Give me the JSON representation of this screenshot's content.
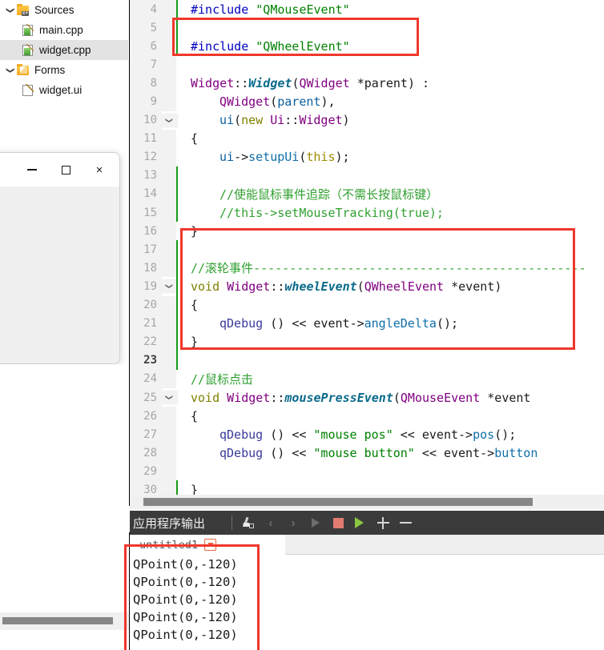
{
  "project_tree": {
    "items": [
      {
        "label": "Sources",
        "icon": "folder-cpp-icon",
        "arrow": "chevron-down-icon",
        "level": 0,
        "selected": false
      },
      {
        "label": "main.cpp",
        "icon": "cpp-file-icon",
        "arrow": "",
        "level": 1,
        "selected": false
      },
      {
        "label": "widget.cpp",
        "icon": "cpp-file-icon",
        "arrow": "",
        "level": 1,
        "selected": true
      },
      {
        "label": "Forms",
        "icon": "folder-forms-icon",
        "arrow": "chevron-down-icon",
        "level": 0,
        "selected": false
      },
      {
        "label": "widget.ui",
        "icon": "ui-file-icon",
        "arrow": "",
        "level": 1,
        "selected": false
      }
    ]
  },
  "app_window": {
    "minimize_label": "minimize-icon",
    "maximize_label": "maximize-icon",
    "close_label": "×"
  },
  "editor": {
    "lines": [
      {
        "n": "4",
        "fold": "",
        "changed": true,
        "current": false,
        "indent": 0,
        "tokens": [
          {
            "t": "#include ",
            "c": "t-pre"
          },
          {
            "t": "\"QMouseEvent\"",
            "c": "t-str"
          }
        ]
      },
      {
        "n": "5",
        "fold": "",
        "changed": true,
        "current": false,
        "indent": 0,
        "tokens": []
      },
      {
        "n": "6",
        "fold": "",
        "changed": true,
        "current": false,
        "indent": 0,
        "tokens": [
          {
            "t": "#include ",
            "c": "t-pre"
          },
          {
            "t": "\"QWheelEvent\"",
            "c": "t-str"
          }
        ]
      },
      {
        "n": "7",
        "fold": "",
        "changed": false,
        "current": false,
        "indent": 0,
        "tokens": []
      },
      {
        "n": "8",
        "fold": "",
        "changed": false,
        "current": false,
        "indent": 0,
        "tokens": [
          {
            "t": "Widget",
            "c": "t-cls"
          },
          {
            "t": "::",
            "c": "t-punct"
          },
          {
            "t": "Widget",
            "c": "t-fn"
          },
          {
            "t": "(",
            "c": "t-punct"
          },
          {
            "t": "QWidget",
            "c": "t-cls"
          },
          {
            "t": " *parent",
            "c": "t-punct"
          },
          {
            "t": ")",
            "c": "t-punct"
          },
          {
            "t": " :",
            "c": "t-punct"
          }
        ]
      },
      {
        "n": "9",
        "fold": "",
        "changed": false,
        "current": false,
        "indent": 1,
        "tokens": [
          {
            "t": "QWidget",
            "c": "t-cls"
          },
          {
            "t": "(",
            "c": "t-punct"
          },
          {
            "t": "parent",
            "c": "t-var"
          },
          {
            "t": "),",
            "c": "t-punct"
          }
        ]
      },
      {
        "n": "10",
        "fold": "chevron-down",
        "changed": false,
        "current": false,
        "indent": 1,
        "tokens": [
          {
            "t": "ui",
            "c": "t-var"
          },
          {
            "t": "(",
            "c": "t-punct"
          },
          {
            "t": "new",
            "c": "t-kw"
          },
          {
            "t": " ",
            "c": "t-punct"
          },
          {
            "t": "Ui",
            "c": "t-cls"
          },
          {
            "t": "::",
            "c": "t-punct"
          },
          {
            "t": "Widget",
            "c": "t-cls"
          },
          {
            "t": ")",
            "c": "t-punct"
          }
        ]
      },
      {
        "n": "11",
        "fold": "",
        "changed": false,
        "current": false,
        "indent": 0,
        "tokens": [
          {
            "t": "{",
            "c": "t-punct"
          }
        ]
      },
      {
        "n": "12",
        "fold": "",
        "changed": false,
        "current": false,
        "indent": 1,
        "tokens": [
          {
            "t": "ui",
            "c": "t-var"
          },
          {
            "t": "->",
            "c": "t-punct"
          },
          {
            "t": "setupUi",
            "c": "t-fn2"
          },
          {
            "t": "(",
            "c": "t-punct"
          },
          {
            "t": "this",
            "c": "t-this"
          },
          {
            "t": ");",
            "c": "t-punct"
          }
        ]
      },
      {
        "n": "13",
        "fold": "",
        "changed": true,
        "current": false,
        "indent": 0,
        "tokens": []
      },
      {
        "n": "14",
        "fold": "",
        "changed": true,
        "current": false,
        "indent": 1,
        "tokens": [
          {
            "t": "//使能鼠标事件追踪（不需长按鼠标键）",
            "c": "t-cmt"
          }
        ]
      },
      {
        "n": "15",
        "fold": "",
        "changed": true,
        "current": false,
        "indent": 1,
        "tokens": [
          {
            "t": "//this->setMouseTracking(true);",
            "c": "t-cmt"
          }
        ]
      },
      {
        "n": "16",
        "fold": "",
        "changed": false,
        "current": false,
        "indent": 0,
        "tokens": [
          {
            "t": "}",
            "c": "t-punct"
          }
        ]
      },
      {
        "n": "17",
        "fold": "",
        "changed": true,
        "current": false,
        "indent": 0,
        "tokens": []
      },
      {
        "n": "18",
        "fold": "",
        "changed": true,
        "current": false,
        "indent": 0,
        "tokens": [
          {
            "t": "//滚轮事件----------------------------------------------",
            "c": "t-cmt"
          }
        ]
      },
      {
        "n": "19",
        "fold": "chevron-down",
        "changed": true,
        "current": false,
        "indent": 0,
        "tokens": [
          {
            "t": "void",
            "c": "t-kw"
          },
          {
            "t": " ",
            "c": "t-punct"
          },
          {
            "t": "Widget",
            "c": "t-cls"
          },
          {
            "t": "::",
            "c": "t-punct"
          },
          {
            "t": "wheelEvent",
            "c": "t-fn"
          },
          {
            "t": "(",
            "c": "t-punct"
          },
          {
            "t": "QWheelEvent",
            "c": "t-cls"
          },
          {
            "t": " *event",
            "c": "t-punct"
          },
          {
            "t": ")",
            "c": "t-punct"
          }
        ]
      },
      {
        "n": "20",
        "fold": "",
        "changed": true,
        "current": false,
        "indent": 0,
        "tokens": [
          {
            "t": "{",
            "c": "t-punct"
          }
        ]
      },
      {
        "n": "21",
        "fold": "",
        "changed": true,
        "current": false,
        "indent": 1,
        "tokens": [
          {
            "t": "qDebug",
            "c": "t-local"
          },
          {
            "t": " () ",
            "c": "t-punct"
          },
          {
            "t": "<<",
            "c": "t-punct"
          },
          {
            "t": " event",
            "c": "t-punct"
          },
          {
            "t": "->",
            "c": "t-punct"
          },
          {
            "t": "angleDelta",
            "c": "t-fn2"
          },
          {
            "t": "();",
            "c": "t-punct"
          }
        ]
      },
      {
        "n": "22",
        "fold": "",
        "changed": true,
        "current": false,
        "indent": 0,
        "tokens": [
          {
            "t": "}",
            "c": "t-punct"
          }
        ]
      },
      {
        "n": "23",
        "fold": "",
        "changed": true,
        "current": true,
        "indent": 0,
        "tokens": []
      },
      {
        "n": "24",
        "fold": "",
        "changed": false,
        "current": false,
        "indent": 0,
        "tokens": [
          {
            "t": "//鼠标点击",
            "c": "t-cmt"
          }
        ]
      },
      {
        "n": "25",
        "fold": "chevron-down",
        "changed": false,
        "current": false,
        "indent": 0,
        "tokens": [
          {
            "t": "void",
            "c": "t-kw"
          },
          {
            "t": " ",
            "c": "t-punct"
          },
          {
            "t": "Widget",
            "c": "t-cls"
          },
          {
            "t": "::",
            "c": "t-punct"
          },
          {
            "t": "mousePressEvent",
            "c": "t-fn"
          },
          {
            "t": "(",
            "c": "t-punct"
          },
          {
            "t": "QMouseEvent",
            "c": "t-cls"
          },
          {
            "t": " *event",
            "c": "t-punct"
          }
        ]
      },
      {
        "n": "26",
        "fold": "",
        "changed": false,
        "current": false,
        "indent": 0,
        "tokens": [
          {
            "t": "{",
            "c": "t-punct"
          }
        ]
      },
      {
        "n": "27",
        "fold": "",
        "changed": false,
        "current": false,
        "indent": 1,
        "tokens": [
          {
            "t": "qDebug",
            "c": "t-local"
          },
          {
            "t": " () ",
            "c": "t-punct"
          },
          {
            "t": "<<",
            "c": "t-punct"
          },
          {
            "t": " ",
            "c": "t-punct"
          },
          {
            "t": "\"mouse pos\"",
            "c": "t-str"
          },
          {
            "t": " ",
            "c": "t-punct"
          },
          {
            "t": "<<",
            "c": "t-punct"
          },
          {
            "t": " event",
            "c": "t-punct"
          },
          {
            "t": "->",
            "c": "t-punct"
          },
          {
            "t": "pos",
            "c": "t-fn2"
          },
          {
            "t": "();",
            "c": "t-punct"
          }
        ]
      },
      {
        "n": "28",
        "fold": "",
        "changed": false,
        "current": false,
        "indent": 1,
        "tokens": [
          {
            "t": "qDebug",
            "c": "t-local"
          },
          {
            "t": " () ",
            "c": "t-punct"
          },
          {
            "t": "<<",
            "c": "t-punct"
          },
          {
            "t": " ",
            "c": "t-punct"
          },
          {
            "t": "\"mouse button\"",
            "c": "t-str"
          },
          {
            "t": " ",
            "c": "t-punct"
          },
          {
            "t": "<<",
            "c": "t-punct"
          },
          {
            "t": " event",
            "c": "t-punct"
          },
          {
            "t": "->",
            "c": "t-punct"
          },
          {
            "t": "button",
            "c": "t-fn2"
          }
        ]
      },
      {
        "n": "29",
        "fold": "",
        "changed": false,
        "current": false,
        "indent": 0,
        "tokens": []
      },
      {
        "n": "30",
        "fold": "",
        "changed": true,
        "current": false,
        "indent": 0,
        "tokens": [
          {
            "t": "}",
            "c": "t-punct"
          }
        ]
      }
    ]
  },
  "output_panel": {
    "title": "应用程序输出",
    "tools": [
      {
        "name": "clear-output-icon",
        "kind": "broom"
      },
      {
        "name": "previous-item-icon",
        "kind": "chev",
        "glyph": "‹"
      },
      {
        "name": "next-item-icon",
        "kind": "chev",
        "glyph": "›"
      },
      {
        "name": "run-icon",
        "kind": "play"
      },
      {
        "name": "stop-icon",
        "kind": "stop"
      },
      {
        "name": "run-debug-icon",
        "kind": "rundbg"
      },
      {
        "name": "zoom-in-icon",
        "kind": "plus"
      },
      {
        "name": "zoom-out-icon",
        "kind": "minus"
      }
    ],
    "tab_label": "untitled1",
    "lines": [
      "QPoint(0,-120)",
      "QPoint(0,-120)",
      "QPoint(0,-120)",
      "QPoint(0,-120)",
      "QPoint(0,-120)"
    ]
  },
  "annotations": {
    "box_color": "#f0372c",
    "boxes": [
      {
        "name": "include-highlight"
      },
      {
        "name": "wheel-event-highlight"
      },
      {
        "name": "output-highlight"
      }
    ]
  }
}
